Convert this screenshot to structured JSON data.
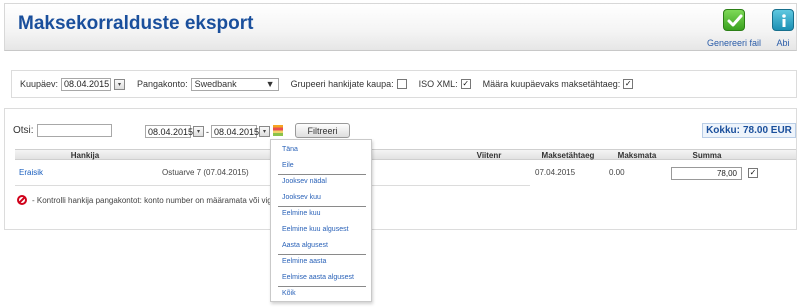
{
  "header": {
    "title": "Maksekorralduste eksport",
    "generate_label": "Genereeri fail",
    "help_label": "Abi",
    "generate_color": "#3aa11f",
    "help_color": "#1c8fb3"
  },
  "filters": {
    "date_label": "Kuupäev:",
    "date_value": "08.04.2015",
    "account_label": "Pangakonto:",
    "account_value": "Swedbank",
    "group_label": "Grupeeri hankijate kaupa:",
    "group_checked": false,
    "iso_label": "ISO XML:",
    "iso_checked": true,
    "due_label": "Määra kuupäevaks maksetähtaeg:",
    "due_checked": true
  },
  "search": {
    "label": "Otsi:",
    "value": "",
    "date_from": "08.04.2015",
    "date_sep": "-",
    "date_to": "08.04.2015",
    "filter_button": "Filtreeri"
  },
  "total": {
    "label": "Kokku:",
    "value": "78.00 EUR"
  },
  "table": {
    "columns": [
      "Hankija",
      "Viitenr",
      "Maksetähtaeg",
      "Maksmata",
      "Summa"
    ],
    "rows": [
      {
        "hankija": "Eraisik",
        "description": "Ostuarve 7 (07.04.2015)",
        "viitenr": "",
        "tahtaeg": "07.04.2015",
        "maksmata": "0.00",
        "summa": "78,00",
        "selected": true
      }
    ]
  },
  "warning": {
    "text": "- Kontrolli hankija pangakontot: konto number on määramata või vigane"
  },
  "date_menu": {
    "items": [
      "Täna",
      "Eile",
      "Jooksev nädal",
      "Jooksev kuu",
      "Eelmine kuu",
      "Eelmine kuu algusest",
      "Aasta algusest",
      "Eelmine aasta",
      "Eelmise aasta algusest",
      "Kõik"
    ]
  },
  "icons": {
    "generate": "check-icon",
    "help": "info-icon",
    "calendar": "calendar-icon",
    "warning": "no-entry-icon"
  }
}
